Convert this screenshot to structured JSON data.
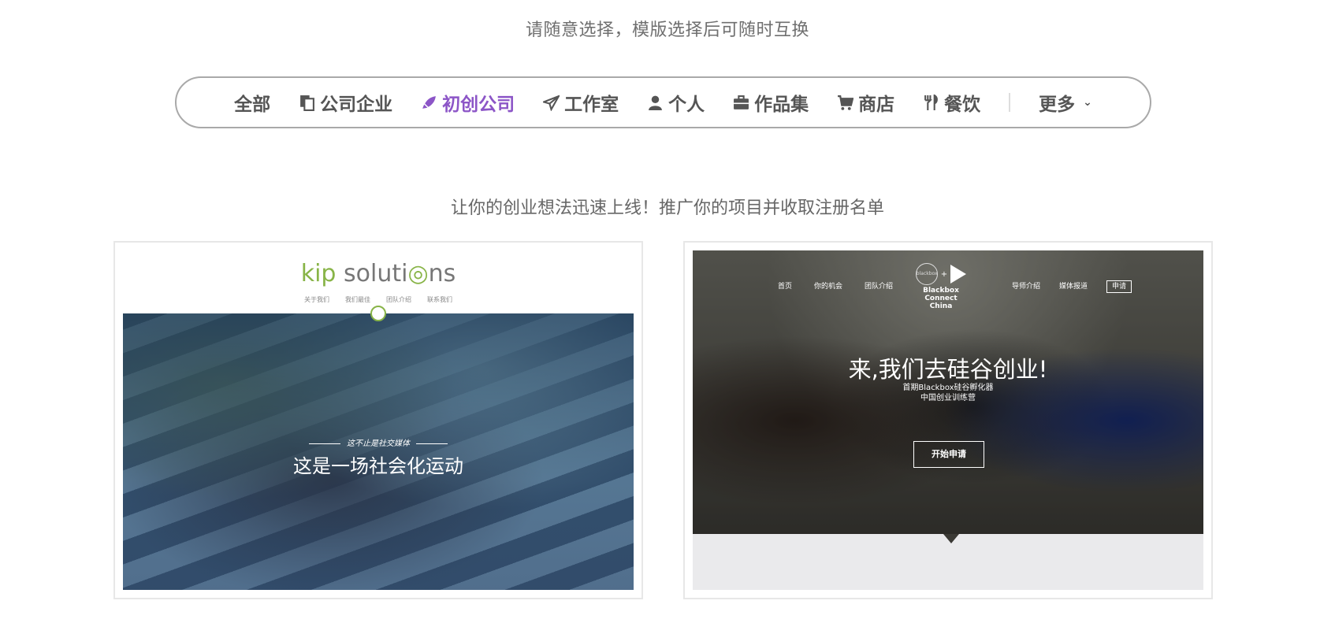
{
  "subtitle": "请随意选择，模版选择后可随时互换",
  "categories": {
    "all": "全部",
    "company": "公司企业",
    "startup": "初创公司",
    "studio": "工作室",
    "personal": "个人",
    "portfolio": "作品集",
    "shop": "商店",
    "food": "餐饮",
    "more": "更多",
    "active_color": "#8c55c7"
  },
  "section_desc": "让你的创业想法迅速上线！推广你的项目并收取注册名单",
  "templates": [
    {
      "logo_green": "kip",
      "logo_rest": " soluti",
      "logo_end": "ns",
      "nav": [
        "关于我们",
        "我们最佳",
        "团队介绍",
        "联系我们"
      ],
      "tagline": "这不止是社交媒体",
      "heading": "这是一场社会化运动"
    },
    {
      "nav_left": [
        "首页",
        "你的机会",
        "团队介绍"
      ],
      "nav_right": [
        "导师介绍",
        "媒体报道"
      ],
      "apply": "申请",
      "logo_small": "blackbox",
      "logo_name": "Blackbox Connect",
      "logo_sub": "China",
      "heading": "来,我们去硅谷创业!",
      "sub1": "首期Blackbox硅谷孵化器",
      "sub2": "中国创业训练营",
      "button": "开始申请"
    }
  ]
}
